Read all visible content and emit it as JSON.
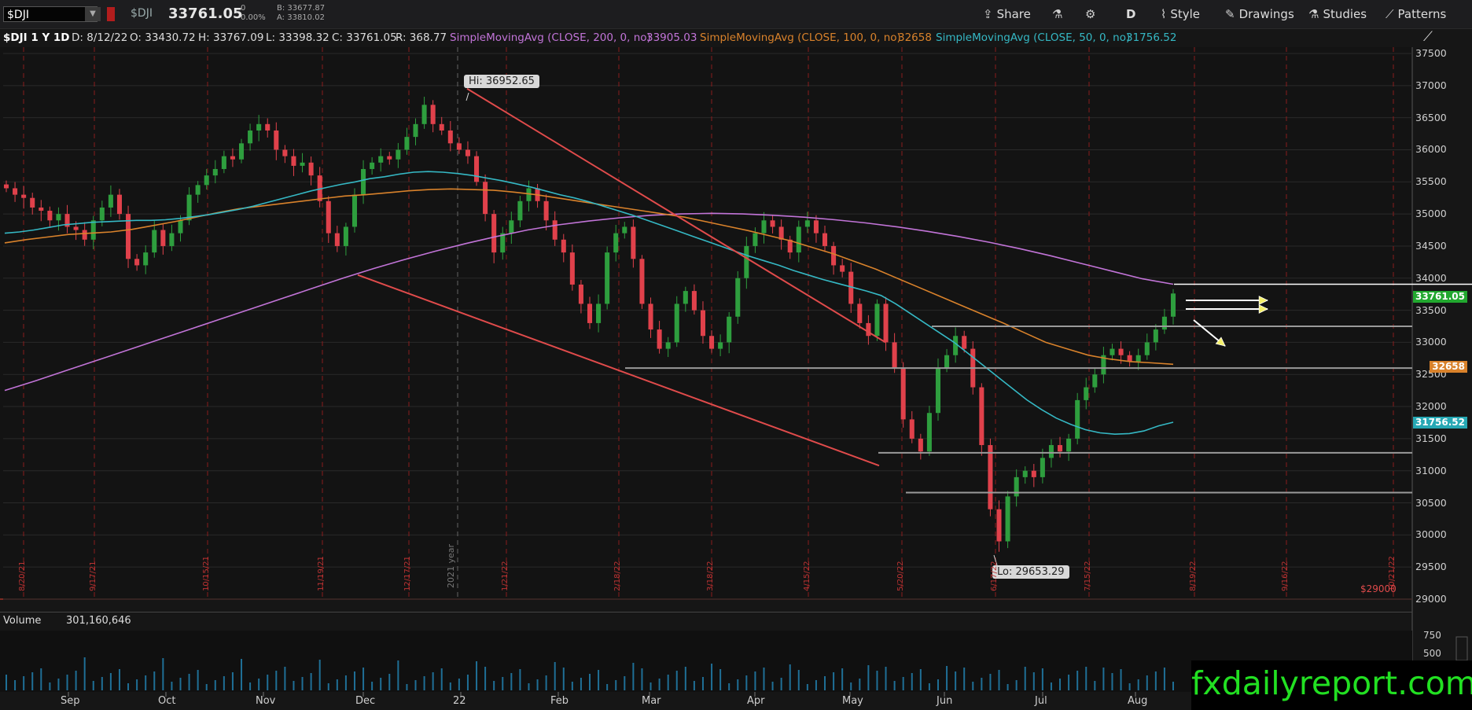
{
  "toolbar": {
    "symbol_input": "$DJI",
    "symbol_name": "$DJI",
    "last_price": "33761.05",
    "net_change": "0",
    "pct_change": "0.00%",
    "bid": "B: 33677.87",
    "ask": "A: 33810.02",
    "buttons": {
      "share": "Share",
      "aggregation": "D",
      "style": "Style",
      "drawings": "Drawings",
      "studies": "Studies",
      "patterns": "Patterns"
    }
  },
  "study_bar": {
    "title": "$DJI 1 Y 1D",
    "date": "D: 8/12/22",
    "open": "O: 33430.72",
    "high": "H: 33767.09",
    "low": "L: 33398.32",
    "close": "C: 33761.05",
    "range": "R: 368.77",
    "sma200_label": "SimpleMovingAvg (CLOSE, 200, 0, no)",
    "sma200_value": "33905.03",
    "sma100_label": "SimpleMovingAvg (CLOSE, 100, 0, no)",
    "sma100_value": "32658",
    "sma50_label": "SimpleMovingAvg (CLOSE, 50, 0, no)",
    "sma50_value": "31756.52"
  },
  "volume": {
    "label": "Volume",
    "value": "301,160,646",
    "axis_labels": [
      "750",
      "500"
    ]
  },
  "brand": "fxdailyreport.com",
  "colors": {
    "up": "#2e9e3e",
    "down": "#e0414b",
    "sma200": "#c274d8",
    "sma100": "#d9822b",
    "sma50": "#35b8c4",
    "trendline": "#e04b4b",
    "level": "#9a9a9a"
  },
  "chart_data": {
    "type": "candlestick",
    "x": [
      "Sep",
      "Oct",
      "Nov",
      "Dec",
      "22",
      "Feb",
      "Mar",
      "Apr",
      "May",
      "Jun",
      "Jul",
      "Aug"
    ],
    "ylim": [
      29000,
      37800
    ],
    "y_ticks": [
      29000,
      29500,
      30000,
      30500,
      31000,
      31500,
      32000,
      32500,
      33000,
      33500,
      34000,
      34500,
      35000,
      35500,
      36000,
      36500,
      37000,
      37500
    ],
    "y_tick_labels": [
      "29000",
      "29500",
      "30000",
      "30500",
      "31000",
      "31500",
      "32000",
      "32500",
      "33000",
      "33500",
      "34000",
      "34500",
      "35000",
      "35500",
      "36000",
      "36500",
      "37000",
      "37500"
    ],
    "price_labels": {
      "last": "33761.05",
      "sma100": "32658",
      "sma50": "31756.52",
      "floor": "$29000"
    },
    "annotations": {
      "high": "Hi: 36952.65",
      "low": "Lo: 29653.29",
      "year_marker": "2021 year"
    },
    "period_dates": [
      "8/20/21",
      "9/17/21",
      "10/15/21",
      "11/19/21",
      "12/17/21",
      "1/21/22",
      "2/18/22",
      "3/18/22",
      "4/15/22",
      "5/20/22",
      "6/17/22",
      "7/15/22",
      "8/19/22",
      "9/16/22",
      "10/21/22"
    ],
    "closes": [
      35400,
      35300,
      35250,
      35100,
      35050,
      34900,
      35000,
      34800,
      34750,
      34600,
      34900,
      35100,
      35300,
      35000,
      34300,
      34200,
      34400,
      34750,
      34500,
      34700,
      34900,
      35300,
      35450,
      35600,
      35700,
      35900,
      35850,
      36100,
      36300,
      36400,
      36300,
      36000,
      35900,
      35750,
      35800,
      35600,
      35200,
      34700,
      34500,
      34800,
      35300,
      35700,
      35800,
      35900,
      35850,
      36000,
      36200,
      36400,
      36700,
      36400,
      36300,
      36100,
      36000,
      35900,
      35500,
      35000,
      34400,
      34700,
      34900,
      35200,
      35400,
      35200,
      34900,
      34600,
      34400,
      33900,
      33600,
      33300,
      33600,
      34400,
      34700,
      34800,
      34300,
      33600,
      33200,
      32900,
      33000,
      33600,
      33800,
      33500,
      33100,
      32900,
      33000,
      33400,
      34000,
      34500,
      34700,
      34900,
      34800,
      34600,
      34400,
      34800,
      34900,
      34700,
      34500,
      34200,
      34100,
      33600,
      33300,
      33100,
      33600,
      33000,
      32600,
      31800,
      31500,
      31300,
      31900,
      32600,
      32800,
      33100,
      32900,
      32300,
      31400,
      30400,
      29900,
      30600,
      30900,
      31000,
      30900,
      31200,
      31400,
      31300,
      31500,
      32100,
      32300,
      32500,
      32800,
      32900,
      32800,
      32700,
      32800,
      33000,
      33200,
      33400,
      33761
    ],
    "sma50": [
      34700,
      34720,
      34750,
      34790,
      34830,
      34850,
      34870,
      34880,
      34890,
      34900,
      34900,
      34910,
      34930,
      34960,
      34990,
      35030,
      35070,
      35120,
      35180,
      35240,
      35300,
      35360,
      35410,
      35460,
      35500,
      35550,
      35580,
      35620,
      35650,
      35660,
      35650,
      35630,
      35600,
      35560,
      35520,
      35470,
      35420,
      35360,
      35300,
      35250,
      35190,
      35120,
      35050,
      34980,
      34900,
      34820,
      34740,
      34660,
      34580,
      34500,
      34420,
      34340,
      34270,
      34200,
      34120,
      34050,
      33980,
      33920,
      33860,
      33800,
      33730,
      33600,
      33450,
      33300,
      33150,
      33000,
      32820,
      32640,
      32460,
      32280,
      32100,
      31950,
      31820,
      31720,
      31640,
      31590,
      31570,
      31580,
      31620,
      31700,
      31756
    ],
    "sma100": [
      34550,
      34600,
      34640,
      34680,
      34700,
      34720,
      34760,
      34820,
      34880,
      34950,
      35020,
      35080,
      35120,
      35160,
      35200,
      35240,
      35280,
      35300,
      35330,
      35360,
      35380,
      35390,
      35380,
      35370,
      35340,
      35300,
      35250,
      35200,
      35150,
      35100,
      35050,
      35000,
      34950,
      34880,
      34810,
      34740,
      34660,
      34580,
      34480,
      34380,
      34260,
      34140,
      34000,
      33860,
      33720,
      33580,
      33440,
      33300,
      33150,
      33000,
      32900,
      32800,
      32740,
      32700,
      32680,
      32658
    ],
    "sma200": [
      32250,
      32400,
      32560,
      32720,
      32880,
      33040,
      33200,
      33360,
      33520,
      33680,
      33840,
      34000,
      34150,
      34290,
      34420,
      34540,
      34650,
      34750,
      34830,
      34890,
      34940,
      34980,
      35000,
      35010,
      35000,
      34980,
      34950,
      34910,
      34860,
      34800,
      34730,
      34650,
      34560,
      34460,
      34350,
      34230,
      34110,
      33990,
      33905
    ],
    "series_names": [
      "$DJI",
      "SimpleMovingAvg (CLOSE, 200, 0, no)",
      "SimpleMovingAvg (CLOSE, 100, 0, no)",
      "SimpleMovingAvg (CLOSE, 50, 0, no)"
    ],
    "support_levels": [
      33250,
      32600,
      31300,
      30650
    ],
    "resistance_level": 33905,
    "trendlines": [
      {
        "from": [
          36952,
          "Jan"
        ],
        "to": [
          33000,
          "May"
        ]
      },
      {
        "from": [
          34100,
          "Dec"
        ],
        "to": [
          31100,
          "May"
        ]
      }
    ],
    "grid": true,
    "legend": "top-left"
  }
}
